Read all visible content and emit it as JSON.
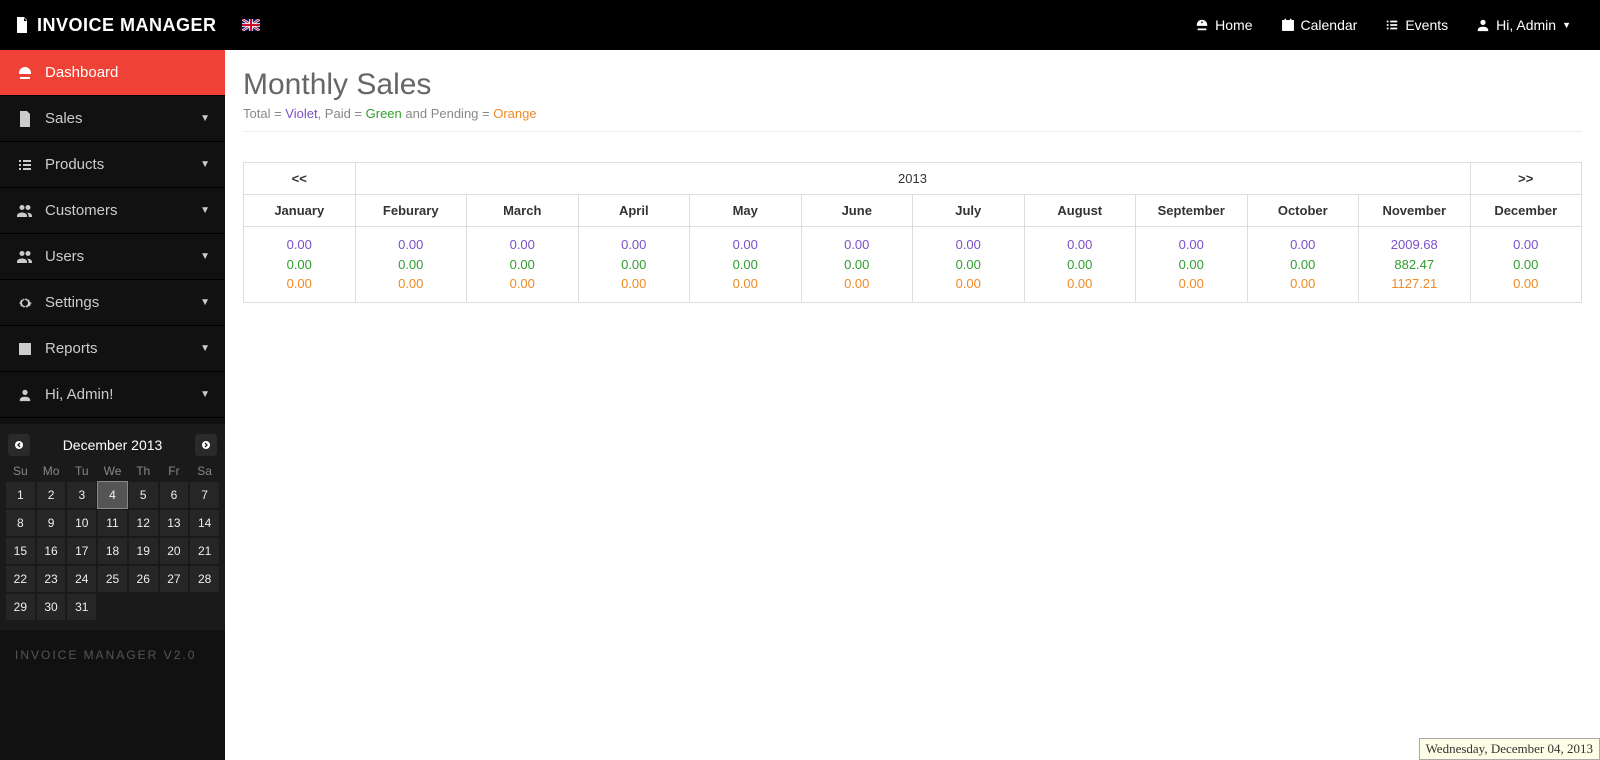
{
  "brand": "INVOICE MANAGER",
  "topnav": {
    "home": "Home",
    "calendar": "Calendar",
    "events": "Events",
    "user": "Hi, Admin"
  },
  "sidebar": {
    "dashboard": "Dashboard",
    "sales": "Sales",
    "products": "Products",
    "customers": "Customers",
    "users": "Users",
    "settings": "Settings",
    "reports": "Reports",
    "user": "Hi, Admin!",
    "footer": "INVOICE MANAGER V2.0"
  },
  "page": {
    "title": "Monthly Sales",
    "legend_total_pre": "Total = ",
    "legend_total": "Violet",
    "legend_paid_pre": ", Paid = ",
    "legend_paid": "Green",
    "legend_pend_pre": " and Pending = ",
    "legend_pend": "Orange"
  },
  "table": {
    "prev": "<<",
    "next": ">>",
    "year": "2013",
    "months": [
      "January",
      "Feburary",
      "March",
      "April",
      "May",
      "June",
      "July",
      "August",
      "September",
      "October",
      "November",
      "December"
    ],
    "rows": [
      {
        "total": "0.00",
        "paid": "0.00",
        "pending": "0.00"
      },
      {
        "total": "0.00",
        "paid": "0.00",
        "pending": "0.00"
      },
      {
        "total": "0.00",
        "paid": "0.00",
        "pending": "0.00"
      },
      {
        "total": "0.00",
        "paid": "0.00",
        "pending": "0.00"
      },
      {
        "total": "0.00",
        "paid": "0.00",
        "pending": "0.00"
      },
      {
        "total": "0.00",
        "paid": "0.00",
        "pending": "0.00"
      },
      {
        "total": "0.00",
        "paid": "0.00",
        "pending": "0.00"
      },
      {
        "total": "0.00",
        "paid": "0.00",
        "pending": "0.00"
      },
      {
        "total": "0.00",
        "paid": "0.00",
        "pending": "0.00"
      },
      {
        "total": "0.00",
        "paid": "0.00",
        "pending": "0.00"
      },
      {
        "total": "2009.68",
        "paid": "882.47",
        "pending": "1127.21"
      },
      {
        "total": "0.00",
        "paid": "0.00",
        "pending": "0.00"
      }
    ]
  },
  "minical": {
    "title": "December 2013",
    "dow": [
      "Su",
      "Mo",
      "Tu",
      "We",
      "Th",
      "Fr",
      "Sa"
    ],
    "days": [
      1,
      2,
      3,
      4,
      5,
      6,
      7,
      8,
      9,
      10,
      11,
      12,
      13,
      14,
      15,
      16,
      17,
      18,
      19,
      20,
      21,
      22,
      23,
      24,
      25,
      26,
      27,
      28,
      29,
      30,
      31
    ],
    "selected": 4
  },
  "status_date": "Wednesday, December 04, 2013"
}
